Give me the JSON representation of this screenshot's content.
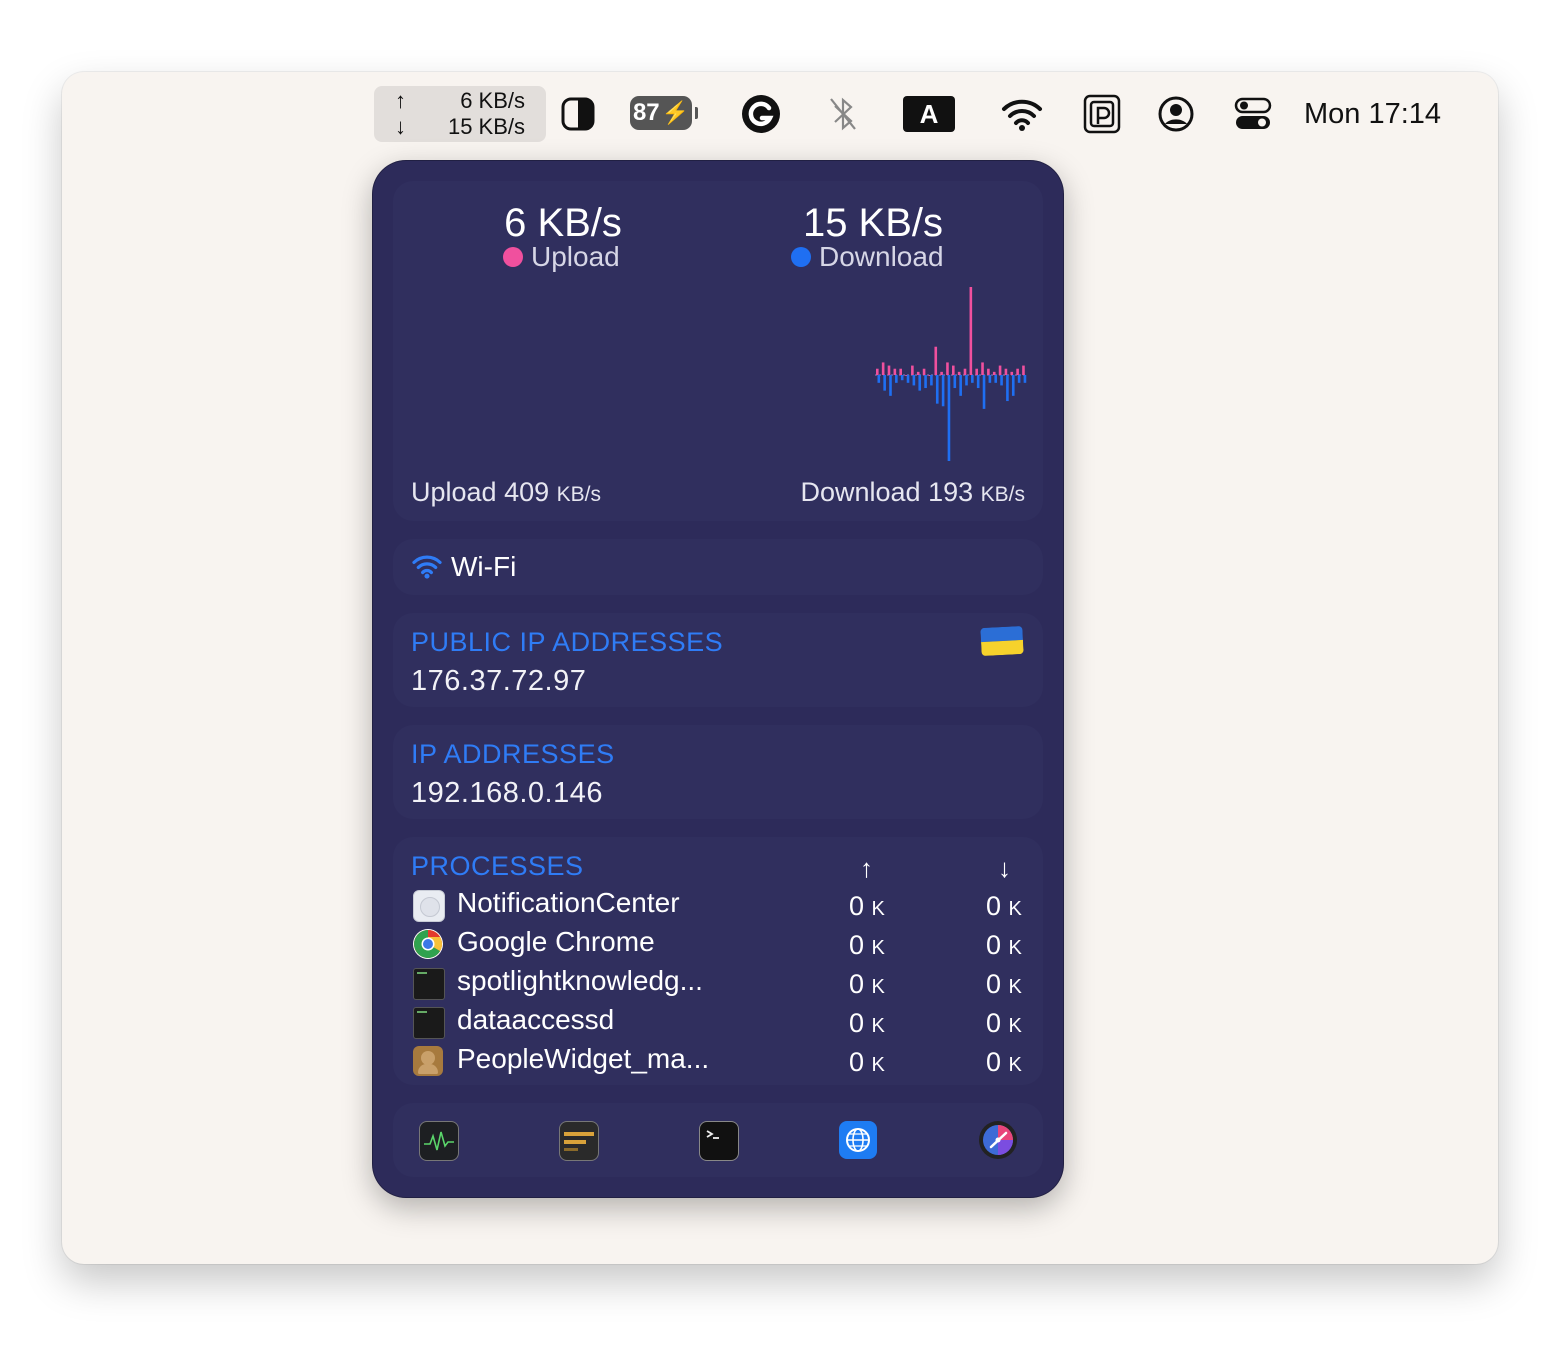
{
  "menubar": {
    "net_upload": "6 KB/s",
    "net_download": "15 KB/s",
    "up_arrow": "↑",
    "down_arrow": "↓",
    "battery": "87",
    "keyboard_input": "A",
    "clock": "Mon 17:14",
    "icons": [
      "contrast-icon",
      "battery-icon",
      "grammarly-icon",
      "bluetooth-off-icon",
      "keyboard-input-icon",
      "wifi-icon",
      "parking-app-icon",
      "user-account-icon",
      "control-center-icon"
    ]
  },
  "panel": {
    "upload_rate": "6 KB/s",
    "upload_label": "Upload",
    "download_rate": "15 KB/s",
    "download_label": "Download",
    "upload_peak_label": "Upload",
    "upload_peak_value": "409",
    "download_peak_label": "Download",
    "download_peak_value": "193",
    "peak_unit": "KB/s",
    "colors": {
      "upload": "#f0509e",
      "download": "#1f6ff2",
      "section_label": "#2f7cf6",
      "panel_bg": "#2d2b5a"
    },
    "chart_upload_bars": [
      2,
      4,
      3,
      2,
      2,
      0,
      3,
      1,
      2,
      0,
      9,
      1,
      4,
      3,
      1,
      2,
      28,
      2,
      4,
      2,
      1,
      3,
      2,
      1,
      2,
      3
    ],
    "chart_download_bars": [
      3,
      6,
      8,
      3,
      2,
      3,
      4,
      6,
      5,
      4,
      11,
      12,
      33,
      5,
      8,
      4,
      3,
      5,
      13,
      3,
      3,
      4,
      10,
      8,
      3,
      3
    ],
    "network": "Wi-Fi",
    "public_ip_label": "PUBLIC IP ADDRESSES",
    "public_ip": "176.37.72.97",
    "ip_label": "IP ADDRESSES",
    "ip": "192.168.0.146",
    "processes_label": "PROCESSES",
    "proc_up_header": "↑",
    "proc_down_header": "↓",
    "processes": [
      {
        "name": "NotificationCenter",
        "up": "0",
        "down": "0"
      },
      {
        "name": "Google Chrome",
        "up": "0",
        "down": "0"
      },
      {
        "name": "spotlightknowledg...",
        "up": "0",
        "down": "0"
      },
      {
        "name": "dataaccessd",
        "up": "0",
        "down": "0"
      },
      {
        "name": "PeopleWidget_ma...",
        "up": "0",
        "down": "0"
      }
    ],
    "proc_unit": "K",
    "apps": [
      "activity-monitor-icon",
      "console-icon",
      "terminal-icon",
      "network-globe-icon",
      "istat-speedometer-icon"
    ]
  }
}
